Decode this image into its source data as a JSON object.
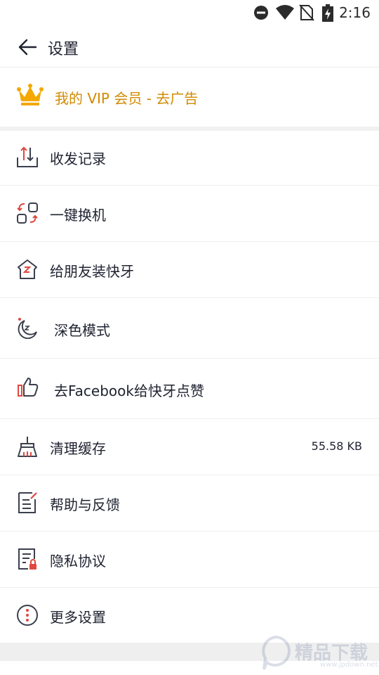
{
  "status_bar": {
    "time": "2:16",
    "icons": [
      "do-not-disturb-icon",
      "wifi-icon",
      "no-sim-icon",
      "battery-charging-icon"
    ]
  },
  "header": {
    "title": "设置",
    "back_icon": "arrow-left-icon"
  },
  "vip": {
    "label": "我的 VIP 会员 - 去广告",
    "icon": "crown-icon",
    "color": "#d28a00"
  },
  "menu": [
    {
      "label": "收发记录",
      "icon": "transfer-history-icon"
    },
    {
      "label": "一键换机",
      "icon": "phone-clone-icon"
    },
    {
      "label": "给朋友装快牙",
      "icon": "install-for-friend-icon"
    },
    {
      "label": "深色模式",
      "icon": "moon-icon"
    },
    {
      "label": "去Facebook给快牙点赞",
      "icon": "thumbs-up-icon"
    },
    {
      "label": "清理缓存",
      "icon": "broom-icon",
      "value": "55.58 KB"
    },
    {
      "label": "帮助与反馈",
      "icon": "feedback-icon"
    },
    {
      "label": "隐私协议",
      "icon": "privacy-document-icon"
    },
    {
      "label": "更多设置",
      "icon": "more-icon"
    }
  ],
  "watermark": {
    "text": "精品下载",
    "sub": "www.jpdown.net"
  },
  "colors": {
    "accent_red": "#e0473f",
    "icon_gray": "#3b3f4e",
    "vip_gold": "#f4a800"
  }
}
